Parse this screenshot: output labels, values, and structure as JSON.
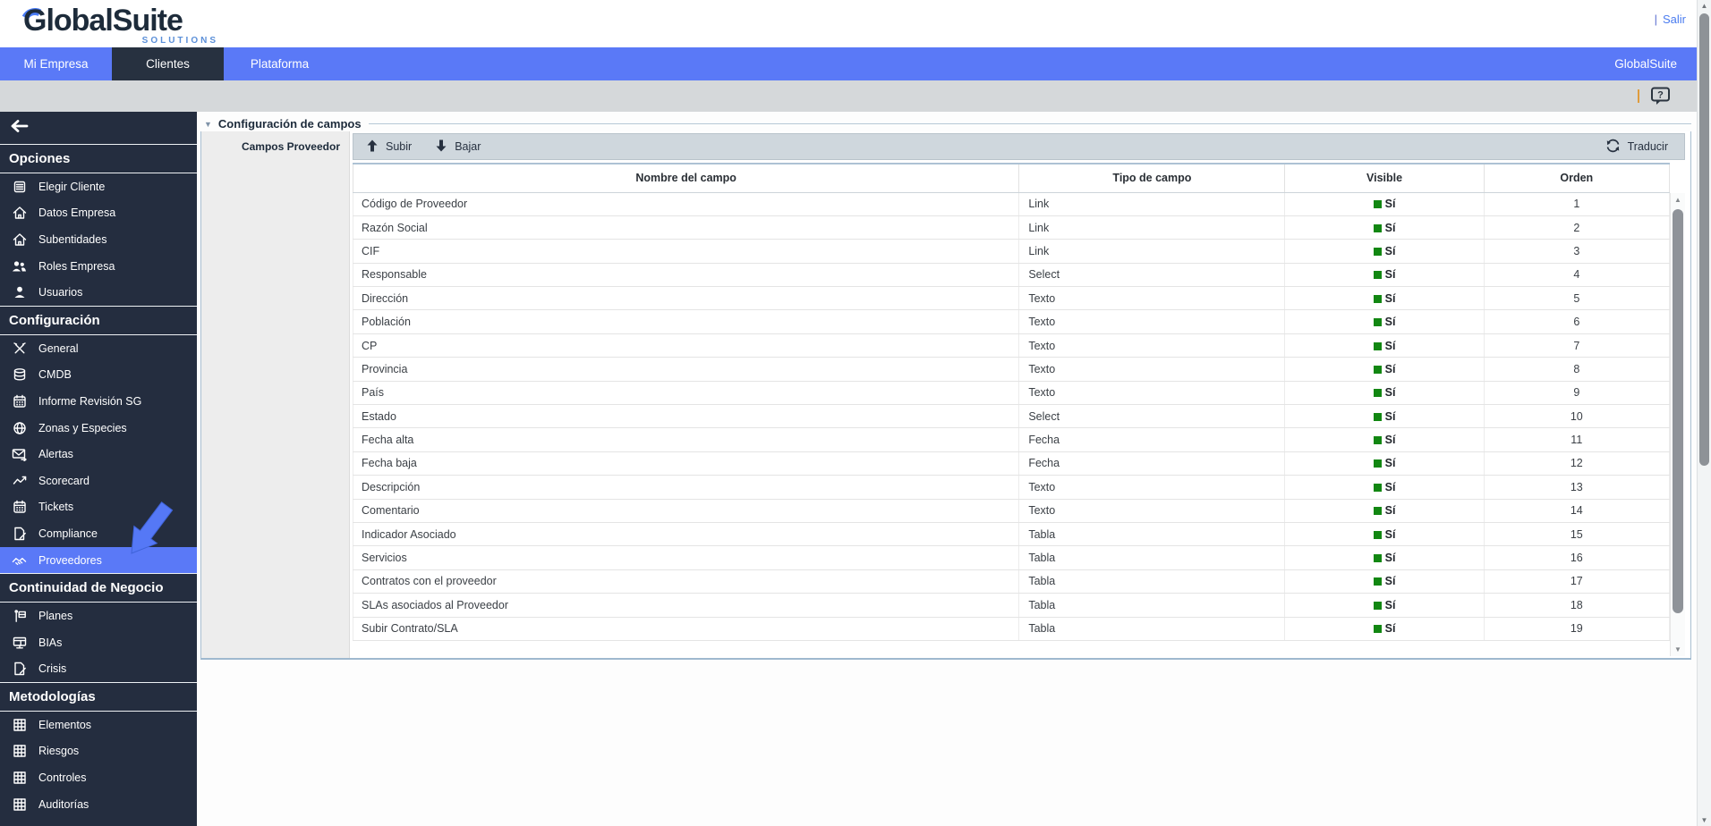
{
  "header": {
    "logo_text": "GlobalSuite",
    "logo_sub": "SOLUTIONS",
    "logout_separator": "|",
    "logout_label": "Salir"
  },
  "nav": {
    "tabs": [
      {
        "label": "Mi Empresa",
        "active": false
      },
      {
        "label": "Clientes",
        "active": true
      },
      {
        "label": "Plataforma",
        "active": false
      }
    ],
    "right_label": "GlobalSuite"
  },
  "sidebar": {
    "back_icon": "arrow-left-icon",
    "sections": [
      {
        "heading": "Opciones",
        "items": [
          {
            "label": "Elegir Cliente",
            "icon": "form-icon"
          },
          {
            "label": "Datos Empresa",
            "icon": "home-icon"
          },
          {
            "label": "Subentidades",
            "icon": "home-icon"
          },
          {
            "label": "Roles Empresa",
            "icon": "users-icon"
          },
          {
            "label": "Usuarios",
            "icon": "user-icon"
          }
        ]
      },
      {
        "heading": "Configuración",
        "items": [
          {
            "label": "General",
            "icon": "tools-icon"
          },
          {
            "label": "CMDB",
            "icon": "database-icon"
          },
          {
            "label": "Informe Revisión SG",
            "icon": "calendar-icon"
          },
          {
            "label": "Zonas y Especies",
            "icon": "globe-icon"
          },
          {
            "label": "Alertas",
            "icon": "mail-icon"
          },
          {
            "label": "Scorecard",
            "icon": "chart-icon"
          },
          {
            "label": "Tickets",
            "icon": "calendar-icon"
          },
          {
            "label": "Compliance",
            "icon": "document-edit-icon"
          },
          {
            "label": "Proveedores",
            "icon": "handshake-icon",
            "selected": true
          }
        ]
      },
      {
        "heading": "Continuidad de Negocio",
        "items": [
          {
            "label": "Planes",
            "icon": "signpost-icon"
          },
          {
            "label": "BIAs",
            "icon": "monitor-icon"
          },
          {
            "label": "Crisis",
            "icon": "document-edit-icon"
          }
        ]
      },
      {
        "heading": "Metodologías",
        "items": [
          {
            "label": "Elementos",
            "icon": "grid-icon"
          },
          {
            "label": "Riesgos",
            "icon": "grid-icon"
          },
          {
            "label": "Controles",
            "icon": "grid-icon"
          },
          {
            "label": "Auditorías",
            "icon": "grid-icon"
          }
        ]
      }
    ]
  },
  "content": {
    "panel_title": "Configuración de campos",
    "field_label": "Campos Proveedor",
    "toolbar": {
      "up_label": "Subir",
      "down_label": "Bajar",
      "translate_label": "Traducir"
    },
    "table": {
      "columns": [
        "Nombre del campo",
        "Tipo de campo",
        "Visible",
        "Orden"
      ],
      "rows": [
        {
          "name": "Código de Proveedor",
          "type": "Link",
          "visible": "Sí",
          "order": "1"
        },
        {
          "name": "Razón Social",
          "type": "Link",
          "visible": "Sí",
          "order": "2"
        },
        {
          "name": "CIF",
          "type": "Link",
          "visible": "Sí",
          "order": "3"
        },
        {
          "name": "Responsable",
          "type": "Select",
          "visible": "Sí",
          "order": "4"
        },
        {
          "name": "Dirección",
          "type": "Texto",
          "visible": "Sí",
          "order": "5"
        },
        {
          "name": "Población",
          "type": "Texto",
          "visible": "Sí",
          "order": "6"
        },
        {
          "name": "CP",
          "type": "Texto",
          "visible": "Sí",
          "order": "7"
        },
        {
          "name": "Provincia",
          "type": "Texto",
          "visible": "Sí",
          "order": "8"
        },
        {
          "name": "País",
          "type": "Texto",
          "visible": "Sí",
          "order": "9"
        },
        {
          "name": "Estado",
          "type": "Select",
          "visible": "Sí",
          "order": "10"
        },
        {
          "name": "Fecha alta",
          "type": "Fecha",
          "visible": "Sí",
          "order": "11"
        },
        {
          "name": "Fecha baja",
          "type": "Fecha",
          "visible": "Sí",
          "order": "12"
        },
        {
          "name": "Descripción",
          "type": "Texto",
          "visible": "Sí",
          "order": "13"
        },
        {
          "name": "Comentario",
          "type": "Texto",
          "visible": "Sí",
          "order": "14"
        },
        {
          "name": "Indicador Asociado",
          "type": "Tabla",
          "visible": "Sí",
          "order": "15"
        },
        {
          "name": "Servicios",
          "type": "Tabla",
          "visible": "Sí",
          "order": "16"
        },
        {
          "name": "Contratos con el proveedor",
          "type": "Tabla",
          "visible": "Sí",
          "order": "17"
        },
        {
          "name": "SLAs asociados al Proveedor",
          "type": "Tabla",
          "visible": "Sí",
          "order": "18"
        },
        {
          "name": "Subir Contrato/SLA",
          "type": "Tabla",
          "visible": "Sí",
          "order": "19"
        }
      ]
    }
  },
  "annotation": {
    "arrow_points_to": "Proveedores"
  },
  "colors": {
    "accent_blue": "#5a79f7",
    "sidebar_dark": "#242d3f",
    "nav_active_dark": "#273140",
    "visible_green": "#128712",
    "link_blue": "#4a7cf0",
    "toolbar_gray": "#cfd7dd"
  }
}
